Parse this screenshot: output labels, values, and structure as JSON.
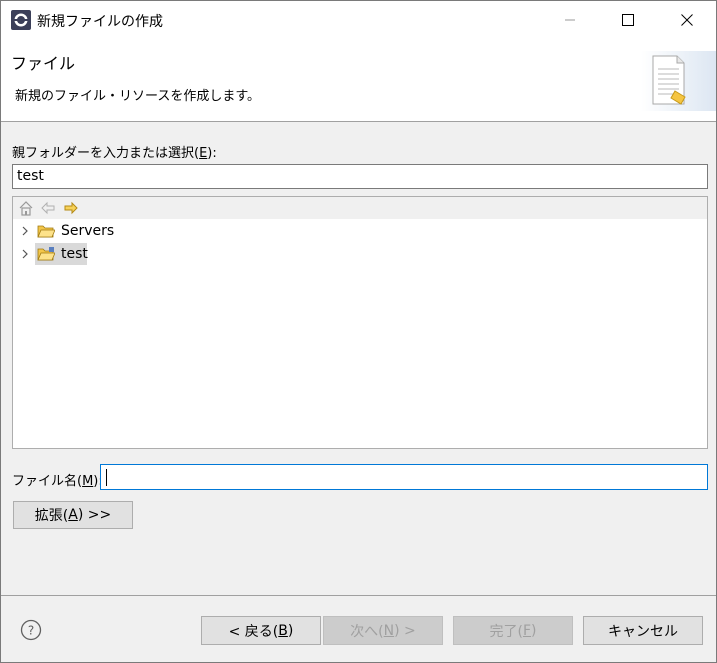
{
  "window": {
    "title": "新規ファイルの作成"
  },
  "banner": {
    "title": "ファイル",
    "description": "新規のファイル・リソースを作成します。",
    "icon": "new-file-wizard-icon"
  },
  "parent_folder": {
    "label_prefix": "親フォルダーを入力または選択(",
    "mnemonic": "E",
    "label_suffix": "):",
    "value": "test"
  },
  "tree": {
    "toolbar": [
      "home-icon",
      "back-arrow-icon",
      "forward-arrow-icon"
    ],
    "items": [
      {
        "label": "Servers",
        "selected": false
      },
      {
        "label": "test",
        "selected": true
      }
    ]
  },
  "file_name": {
    "label_prefix": "ファイル名(",
    "mnemonic": "M",
    "label_suffix": "):",
    "value": ""
  },
  "advanced_button": {
    "label_prefix": "拡張(",
    "mnemonic": "A",
    "label_suffix": ") >>"
  },
  "footer": {
    "back": {
      "prefix": "< 戻る(",
      "mnemonic": "B",
      "suffix": ")"
    },
    "next": {
      "prefix": "次へ(",
      "mnemonic": "N",
      "suffix": ") >"
    },
    "finish": {
      "prefix": "完了(",
      "mnemonic": "F",
      "suffix": ")"
    },
    "cancel": "キャンセル"
  }
}
